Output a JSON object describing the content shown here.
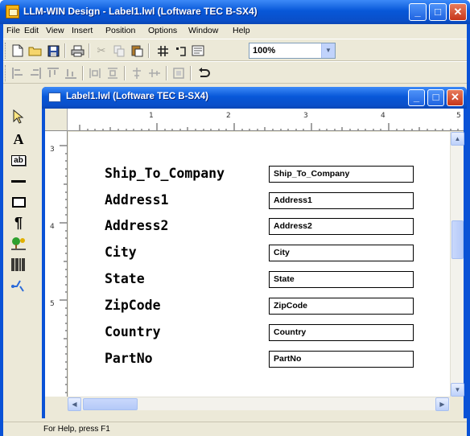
{
  "app": {
    "title": "LLM-WIN Design - Label1.lwl (Loftware TEC B-SX4)",
    "min_glyph": "_",
    "max_glyph": "□",
    "close_glyph": "✕"
  },
  "menu": [
    "File",
    "Edit",
    "View",
    "Insert",
    "Position",
    "Options",
    "Window",
    "Help"
  ],
  "toolbar1": {
    "zoom_value": "100%"
  },
  "child": {
    "title": "Label1.lwl (Loftware TEC B-SX4)"
  },
  "ruler": {
    "horizontal": [
      "1",
      "2",
      "3",
      "4",
      "5"
    ],
    "vertical": [
      "3",
      "4",
      "5"
    ]
  },
  "fields": [
    {
      "label": "Ship_To_Company",
      "value": "Ship_To_Company"
    },
    {
      "label": "Address1",
      "value": "Address1"
    },
    {
      "label": "Address2",
      "value": "Address2"
    },
    {
      "label": "City",
      "value": "City"
    },
    {
      "label": "State",
      "value": "State"
    },
    {
      "label": "ZipCode",
      "value": "ZipCode"
    },
    {
      "label": "Country",
      "value": "Country"
    },
    {
      "label": "PartNo",
      "value": "PartNo"
    }
  ],
  "tools": [
    "A",
    "ab",
    "¶"
  ],
  "status": "For Help, press F1",
  "colors": {
    "titlebar": "#0a52d6",
    "chrome": "#ece9d8",
    "close_button": "#c6361a"
  }
}
